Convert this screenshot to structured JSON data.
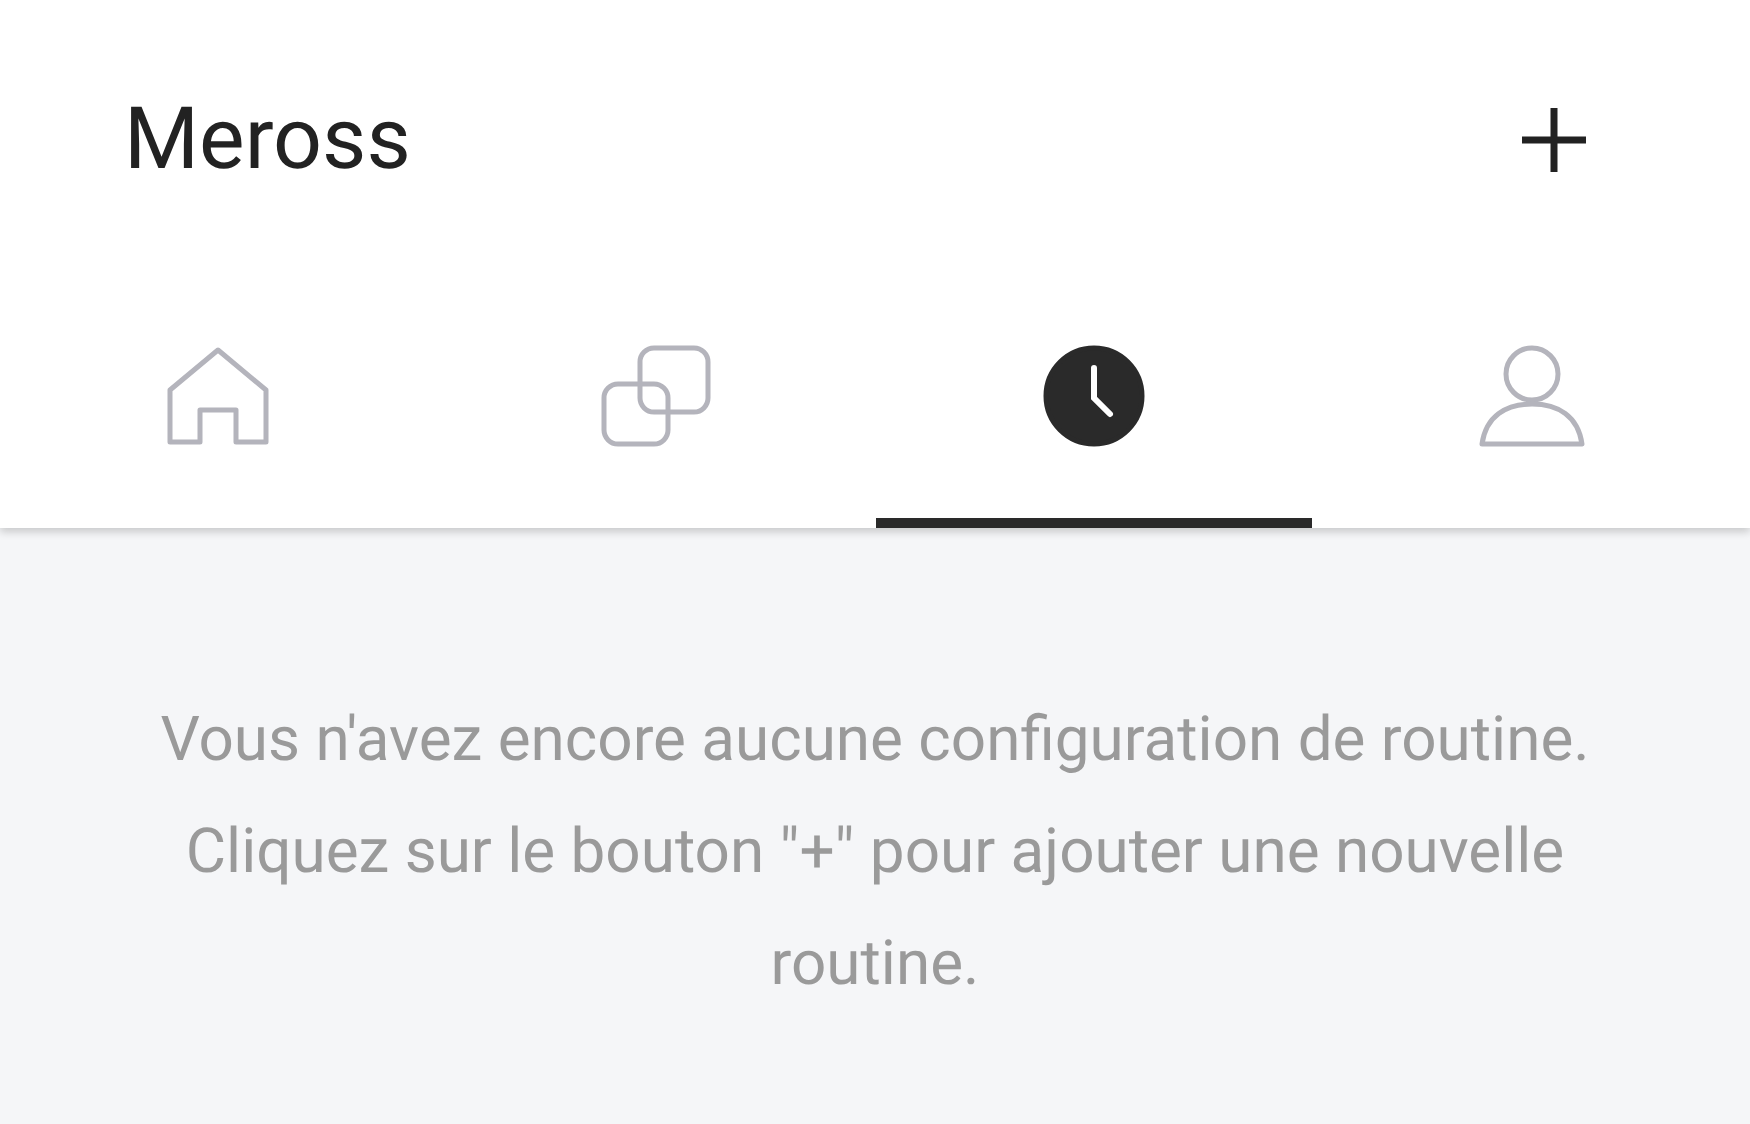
{
  "header": {
    "title": "Meross"
  },
  "tabs": [
    {
      "kind": "home",
      "selected": false
    },
    {
      "kind": "devices",
      "selected": false
    },
    {
      "kind": "clock",
      "selected": true
    },
    {
      "kind": "profile",
      "selected": false
    }
  ],
  "empty_message": "Vous n'avez encore aucune configuration de routine. Cliquez sur le bouton \"+\" pour ajouter une nouvelle routine."
}
